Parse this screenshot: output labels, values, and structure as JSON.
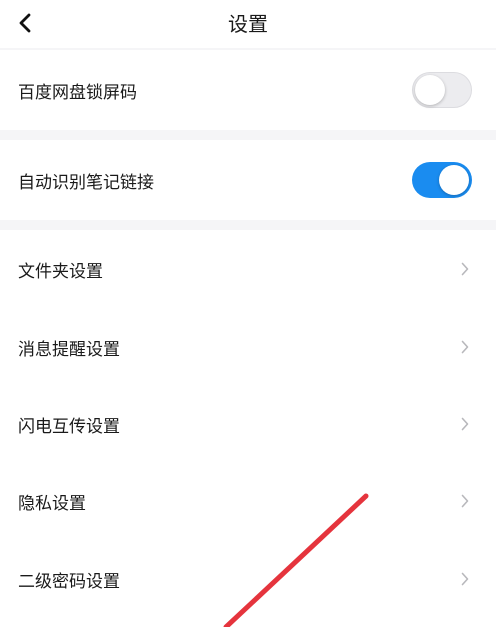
{
  "header": {
    "title": "设置",
    "back_icon": "chevron-left-icon"
  },
  "toggles": {
    "lock_screen": {
      "label": "百度网盘锁屏码",
      "state": "off"
    },
    "auto_detect": {
      "label": "自动识别笔记链接",
      "state": "on",
      "accent_color": "#1a8cf0"
    }
  },
  "settings_items": [
    {
      "label": "文件夹设置"
    },
    {
      "label": "消息提醒设置"
    },
    {
      "label": "闪电互传设置"
    },
    {
      "label": "隐私设置"
    },
    {
      "label": "二级密码设置"
    }
  ],
  "colors": {
    "background": "#ffffff",
    "section_gap": "#f5f5f7",
    "annotation_arrow": "#e5343d"
  }
}
